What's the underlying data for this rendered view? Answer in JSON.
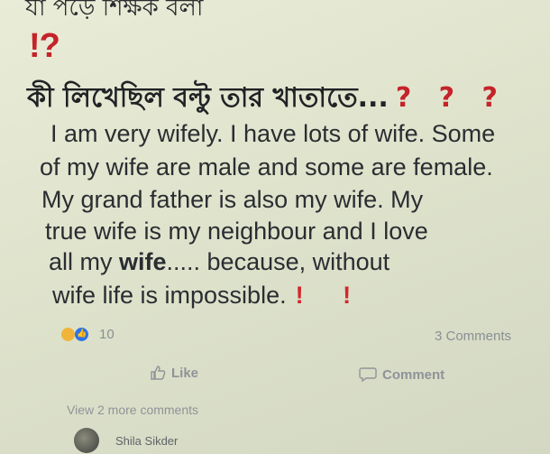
{
  "post": {
    "cut_line_text": "যা পড়ে শিক্ষক বলা",
    "exclaim_question": "!?",
    "bengali_line": "কী লিখেছিল বল্টু তার খাতাতে...",
    "bengali_marks": "? ? ?",
    "body_lines": [
      "I am very wifely. I have lots of wife. Some",
      "of my wife are male and some are female.",
      "My grand father is also my wife. My",
      "true wife is my neighbour and I love"
    ],
    "line_all_my": "all my ",
    "line_wife_bold": "wife",
    "line_after_wife": ".....  because, without",
    "last_line": "wife life is impossible.",
    "last_marks": "! !"
  },
  "reactions": {
    "count": "10",
    "comments": "3 Comments"
  },
  "actions": {
    "like_label": "Like",
    "comment_label": "Comment"
  },
  "comments": {
    "view_more": "View 2 more comments",
    "commenter_name": "Shila Sikder"
  },
  "colors": {
    "accent_red": "#c5232a",
    "like_blue": "#2e74e6",
    "haha_yellow": "#f0b43b"
  },
  "icons": {
    "like": "thumbs-up-icon",
    "comment": "speech-bubble-icon"
  }
}
